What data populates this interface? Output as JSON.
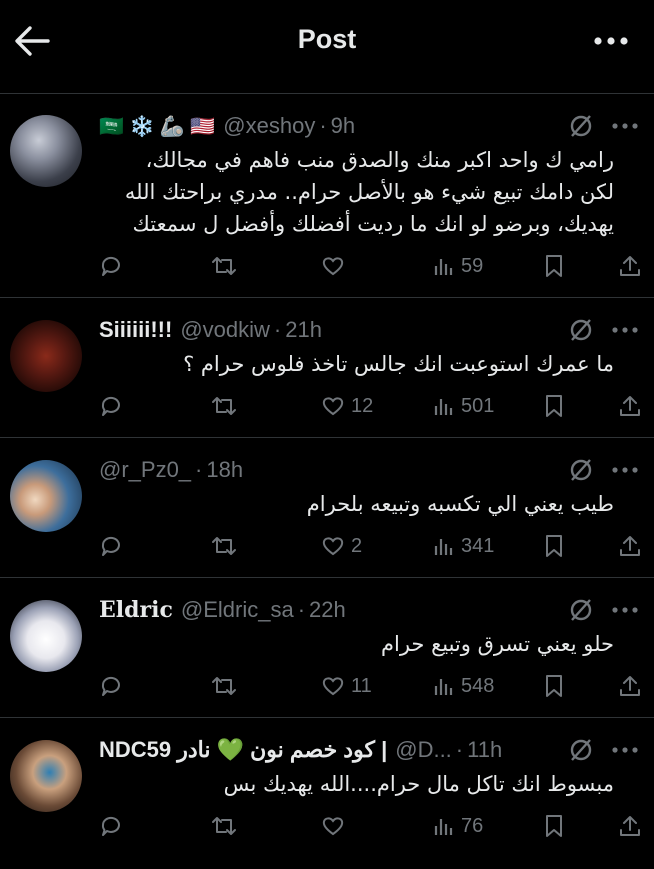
{
  "header": {
    "title": "Post"
  },
  "posts": [
    {
      "name": "🇸🇦 ❄️ 🦾 🇺🇸",
      "handle": "@xeshoy",
      "time": "9h",
      "text": "رامي ك واحد اكبر منك والصدق منب فاهم في مجالك،\nلكن دامك تبيع شيء هو بالأصل حرام.. مدري براحتك الله\nيهديك، وبرضو لو انك ما رديت أفضلك وأفضل ل سمعتك",
      "likes": "",
      "views": "59"
    },
    {
      "name": "Siiiiii!!!",
      "handle": "@vodkiw",
      "time": "21h",
      "text": "ما عمرك استوعبت انك جالس تاخذ فلوس حرام ؟",
      "likes": "12",
      "views": "501"
    },
    {
      "name": "",
      "handle": "@r_Pz0_",
      "time": "18h",
      "text": "طيب يعني الي تكسبه وتبيعه بلحرام",
      "likes": "2",
      "views": "341"
    },
    {
      "name": "Eldric",
      "handle": "@Eldric_sa",
      "time": "22h",
      "text": "حلو يعني تسرق وتبيع حرام",
      "likes": "11",
      "views": "548"
    },
    {
      "name": "NDC59 كود خصم نون 💚 نادر |",
      "handle": "@D...",
      "time": "11h",
      "text": "مبسوط انك تاكل مال حرام....الله يهديك بس",
      "likes": "",
      "views": "76"
    }
  ],
  "colors": {
    "background": "#000000",
    "text": "#e7e9ea",
    "muted": "#71767b",
    "divider": "#2f3336"
  }
}
